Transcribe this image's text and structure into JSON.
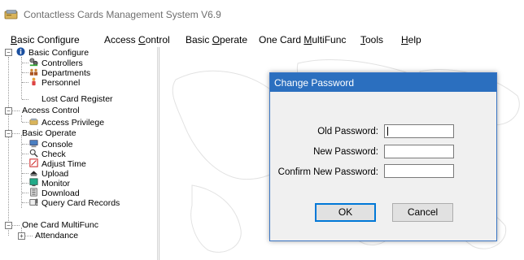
{
  "window": {
    "title": "Contactless Cards Management System  V6.9"
  },
  "menu": [
    {
      "label": "Basic Configure",
      "mnemonic": "B"
    },
    {
      "label": "Access Control",
      "mnemonic": "C"
    },
    {
      "label": "Basic Operate",
      "mnemonic": "O"
    },
    {
      "label": "One Card MultiFunc",
      "mnemonic": "M"
    },
    {
      "label": "Tools",
      "mnemonic": "T"
    },
    {
      "label": "Help",
      "mnemonic": "H"
    }
  ],
  "tree": {
    "basic_configure": {
      "label": "Basic Configure",
      "icon": "info-icon"
    },
    "controllers": {
      "label": "Controllers",
      "icon": "controllers-icon"
    },
    "departments": {
      "label": "Departments",
      "icon": "departments-icon"
    },
    "personnel": {
      "label": "Personnel",
      "icon": "personnel-icon"
    },
    "lost_card": {
      "label": "Lost Card Register"
    },
    "access_control": {
      "label": "Access Control"
    },
    "access_privilege": {
      "label": "Access Privilege",
      "icon": "access-card-icon"
    },
    "basic_operate": {
      "label": "Basic Operate"
    },
    "console": {
      "label": "Console",
      "icon": "console-icon"
    },
    "check": {
      "label": "Check",
      "icon": "check-icon"
    },
    "adjust_time": {
      "label": "Adjust Time",
      "icon": "adjust-time-icon"
    },
    "upload": {
      "label": "Upload",
      "icon": "upload-icon"
    },
    "monitor": {
      "label": "Monitor",
      "icon": "monitor-icon"
    },
    "download": {
      "label": "Download",
      "icon": "download-icon"
    },
    "query_records": {
      "label": "Query Card Records",
      "icon": "query-records-icon"
    },
    "one_card": {
      "label": "One Card MultiFunc"
    },
    "attendance": {
      "label": "Attendance"
    }
  },
  "dialog": {
    "title": "Change Password",
    "old_password_label": "Old Password:",
    "new_password_label": "New Password:",
    "confirm_password_label": "Confirm New Password:",
    "old_password_value": "",
    "new_password_value": "",
    "confirm_password_value": "",
    "ok_label": "OK",
    "cancel_label": "Cancel"
  },
  "colors": {
    "dialog_title": "#2b6fbf",
    "dialog_body": "#f0f0f0",
    "default_button_border": "#0078d7"
  }
}
